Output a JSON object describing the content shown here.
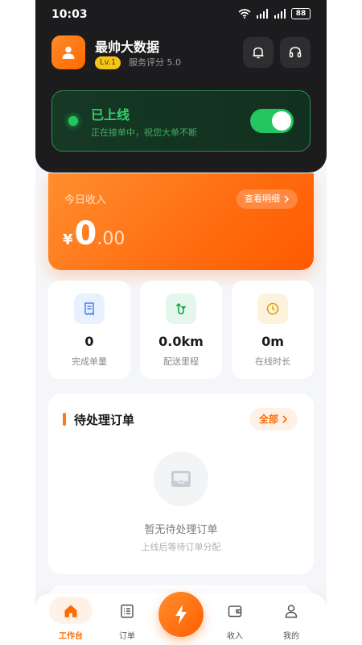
{
  "status_bar": {
    "time": "10:03",
    "battery": "88"
  },
  "user": {
    "name": "最帅大数据",
    "level": "Lv.1",
    "score_label": "服务评分 5.0"
  },
  "online": {
    "title": "已上线",
    "subtitle": "正在接单中，祝您大单不断",
    "enabled": true
  },
  "income": {
    "label": "今日收入",
    "detail_label": "查看明细",
    "currency": "¥",
    "integer": "0",
    "decimal": ".00"
  },
  "stats": [
    {
      "value": "0",
      "label": "完成单量",
      "icon": "receipt-icon"
    },
    {
      "value": "0.0km",
      "label": "配送里程",
      "icon": "route-icon"
    },
    {
      "value": "0m",
      "label": "在线时长",
      "icon": "clock-icon"
    }
  ],
  "pending": {
    "title": "待处理订单",
    "all_label": "全部",
    "empty_title": "暂无待处理订单",
    "empty_subtitle": "上线后等待订单分配"
  },
  "nav": [
    {
      "label": "工作台",
      "icon": "home-icon",
      "active": true
    },
    {
      "label": "订单",
      "icon": "list-icon",
      "active": false
    },
    {
      "label": "收入",
      "icon": "wallet-icon",
      "active": false
    },
    {
      "label": "我的",
      "icon": "person-icon",
      "active": false
    }
  ],
  "colors": {
    "accent": "#ff6a00",
    "online_green": "#22c55e",
    "header_dark": "#1c1c1e"
  }
}
